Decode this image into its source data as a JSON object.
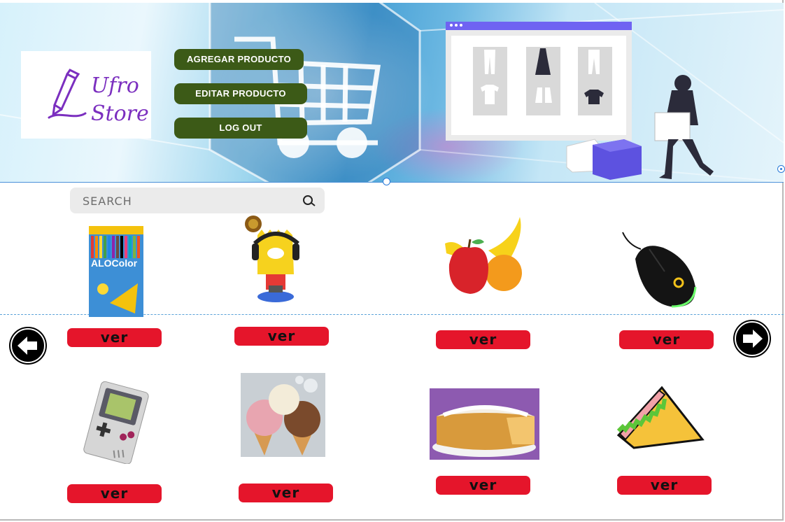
{
  "app": {
    "name_line1": "Ufro",
    "name_line2": "Store"
  },
  "header": {
    "add_label": "AGREGAR PRODUCTO",
    "edit_label": "EDITAR PRODUCTO",
    "logout_label": "LOG OUT"
  },
  "search": {
    "placeholder": "SEARCH"
  },
  "products": [
    {
      "icon": "colored-pencils-box",
      "view_label": "ver",
      "image_text": "ALOColor"
    },
    {
      "icon": "bart-funko-figure",
      "view_label": "ver"
    },
    {
      "icon": "fruits",
      "view_label": "ver"
    },
    {
      "icon": "gaming-mouse",
      "view_label": "ver"
    },
    {
      "icon": "gameboy",
      "view_label": "ver"
    },
    {
      "icon": "ice-cream-cones",
      "view_label": "ver"
    },
    {
      "icon": "cake",
      "view_label": "ver"
    },
    {
      "icon": "sandwich",
      "view_label": "ver"
    }
  ],
  "nav": {
    "prev_icon": "arrow-left-icon",
    "next_icon": "arrow-right-icon"
  },
  "colors": {
    "button_green": "#3c5a17",
    "ver_red": "#e5152b",
    "brand_purple": "#7b2fbf",
    "window_bar": "#6f63f2"
  }
}
